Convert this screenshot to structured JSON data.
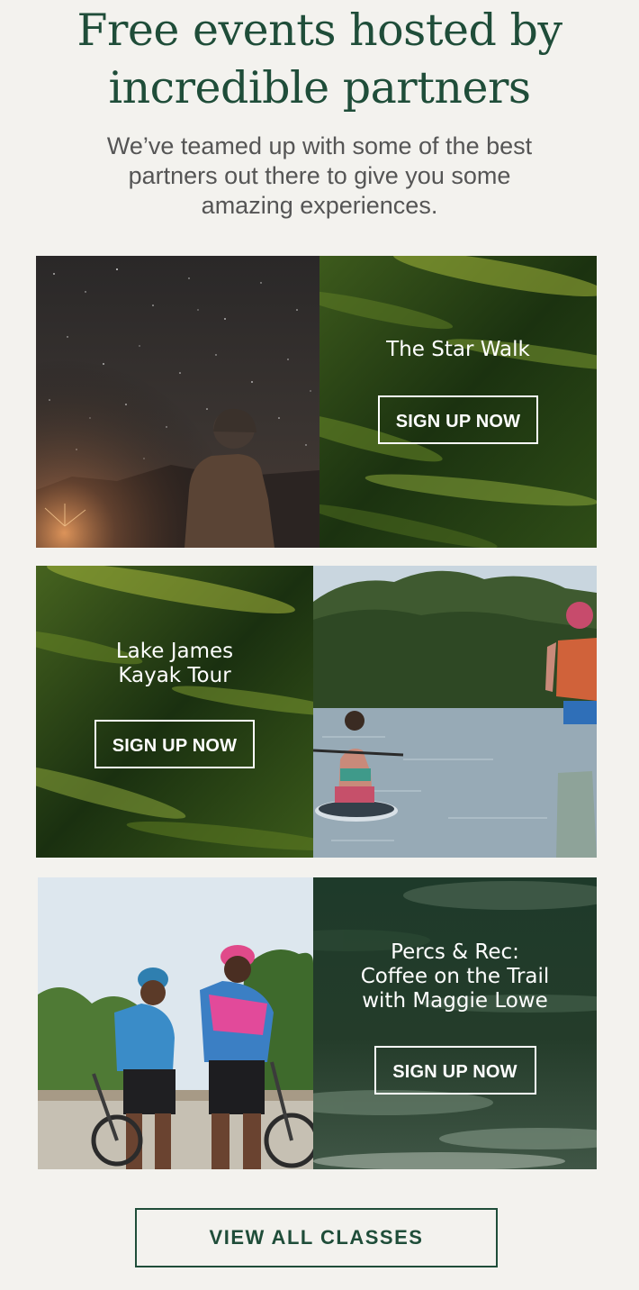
{
  "header": {
    "title_line1": "Free events hosted by",
    "title_line2": "incredible partners",
    "subtitle_line1": "We’ve teamed up with some of the best",
    "subtitle_line2": "partners out there to give you some",
    "subtitle_line3": "amazing experiences."
  },
  "events": [
    {
      "title": "The Star Walk",
      "button_label": "SIGN UP NOW",
      "photo_icon": "night-sky-hiker-photo"
    },
    {
      "title": "Lake James\nKayak Tour",
      "button_label": "SIGN UP NOW",
      "photo_icon": "paddleboard-lake-photo"
    },
    {
      "title": "Percs & Rec:\nCoffee on the Trail\nwith Maggie Lowe",
      "button_label": "SIGN UP NOW",
      "photo_icon": "cyclists-river-photo"
    }
  ],
  "cta": {
    "label": "VIEW ALL CLASSES"
  },
  "colors": {
    "brand_green": "#1f4d39",
    "background": "#f3f2ee",
    "body_text": "#555555"
  }
}
